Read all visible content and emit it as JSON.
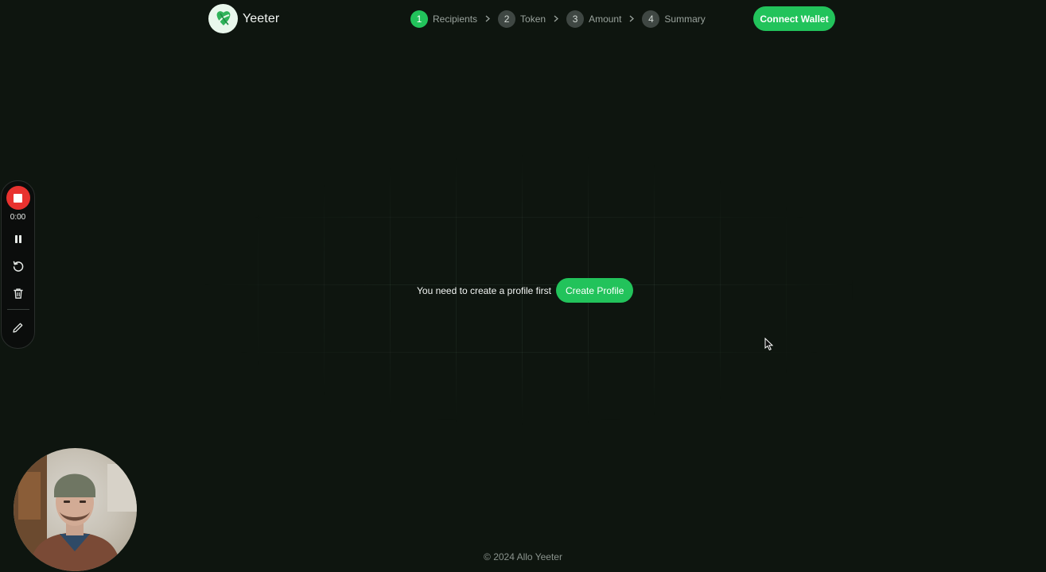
{
  "app": {
    "name": "Yeeter"
  },
  "steps": [
    {
      "number": "1",
      "label": "Recipients",
      "active": true
    },
    {
      "number": "2",
      "label": "Token",
      "active": false
    },
    {
      "number": "3",
      "label": "Amount",
      "active": false
    },
    {
      "number": "4",
      "label": "Summary",
      "active": false
    }
  ],
  "header": {
    "connect_label": "Connect Wallet"
  },
  "main": {
    "message": "You need to create a profile first",
    "create_label": "Create Profile"
  },
  "recorder": {
    "time": "0:00"
  },
  "footer": {
    "text": "© 2024 Allo Yeeter"
  },
  "colors": {
    "accent": "#22c35b",
    "background": "#0e150f",
    "record_red": "#e8322f"
  },
  "icons": [
    "yeeter-logo",
    "chevron-right-icon",
    "stop-icon",
    "pause-icon",
    "restart-icon",
    "trash-icon",
    "pencil-icon",
    "mouse-cursor-icon"
  ]
}
